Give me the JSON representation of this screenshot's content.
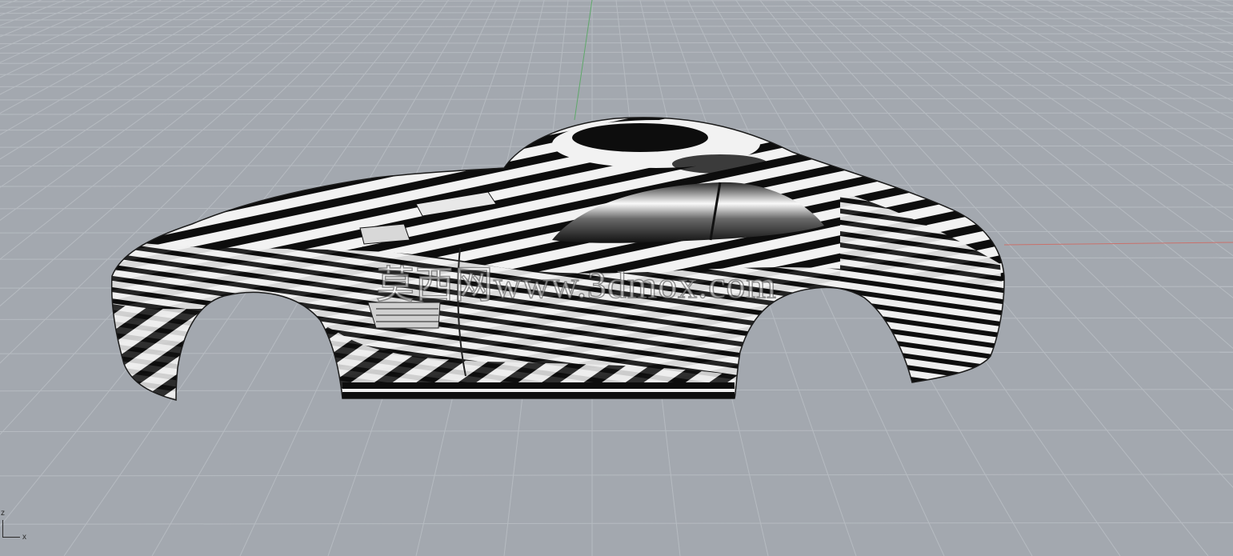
{
  "viewport": {
    "background_color": "#a3a8af",
    "grid_color": "#b6bbc1",
    "axis_x_color": "#c9716b",
    "axis_y_color": "#5fa86a",
    "shading_mode": "zebra-analysis"
  },
  "model": {
    "subject": "sports car body",
    "stripe_dark": "#0d0d0d",
    "stripe_light": "#f2f2f2"
  },
  "watermark": {
    "text": "莫西网www.3dmox.com"
  },
  "axis_widget": {
    "z_label": "z",
    "x_label": "x"
  }
}
